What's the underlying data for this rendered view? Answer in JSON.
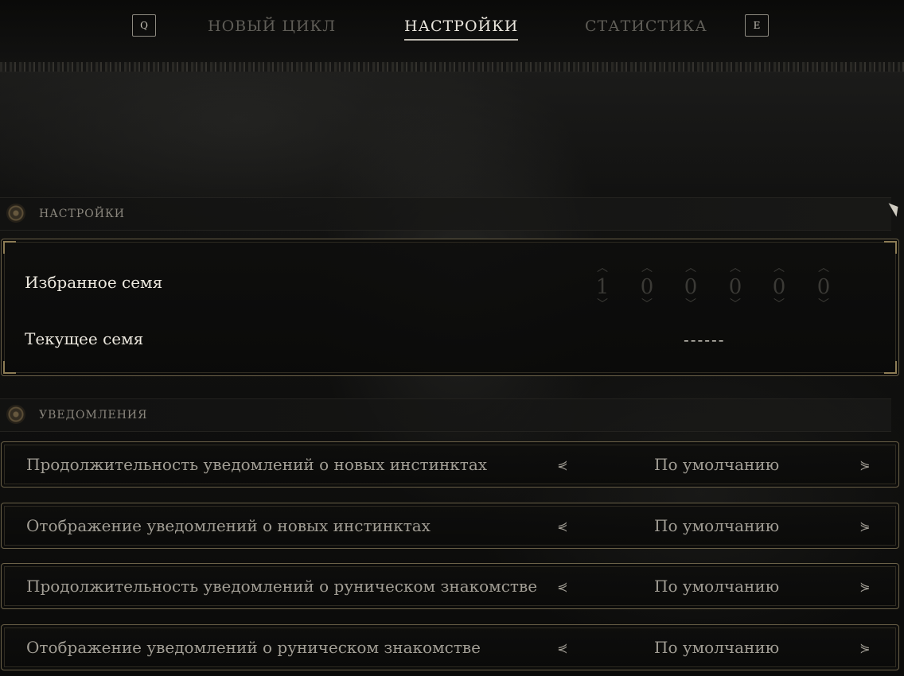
{
  "nav": {
    "left_key": "Q",
    "right_key": "E",
    "tabs": [
      {
        "label": "НОВЫЙ ЦИКЛ",
        "active": false
      },
      {
        "label": "НАСТРОЙКИ",
        "active": true
      },
      {
        "label": "СТАТИСТИКА",
        "active": false
      }
    ]
  },
  "settings_section": {
    "title": "НАСТРОЙКИ",
    "favorite_seed_label": "Избранное семя",
    "favorite_seed_digits": [
      "1",
      "0",
      "0",
      "0",
      "0",
      "0"
    ],
    "current_seed_label": "Текущее семя",
    "current_seed_value": "------"
  },
  "notifications_section": {
    "title": "УВЕДОМЛЕНИЯ",
    "options": [
      {
        "label": "Продолжительность уведомлений о новых инстинктах",
        "value": "По умолчанию"
      },
      {
        "label": "Отображение уведомлений о новых инстинктах",
        "value": "По умолчанию"
      },
      {
        "label": "Продолжительность уведомлений о руническом знакомстве",
        "value": "По умолчанию"
      },
      {
        "label": "Отображение уведомлений о руническом знакомстве",
        "value": "По умолчанию"
      }
    ]
  },
  "colors": {
    "background": "#0d0d0c",
    "panel_border": "#6b6148",
    "text_primary": "#ece8de",
    "text_muted": "#a29e95",
    "inactive_tab": "#5f5d57"
  },
  "icons": {
    "section_emblem": "ornate-circle-icon",
    "prev": "double-chevron-left-icon",
    "next": "double-chevron-right-icon",
    "digit_up": "chevron-up-icon",
    "digit_down": "chevron-down-icon"
  }
}
